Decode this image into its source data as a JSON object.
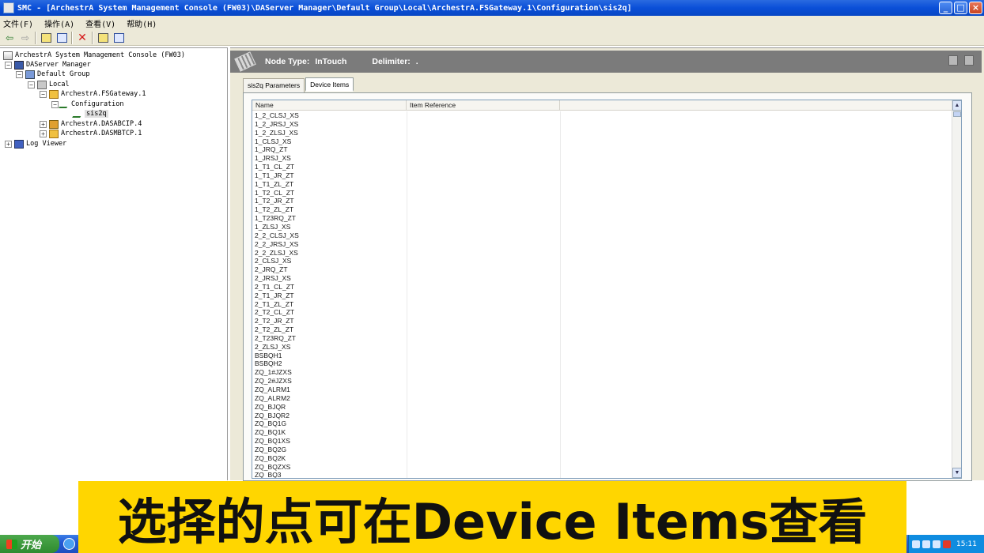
{
  "window": {
    "title": "SMC - [ArchestrA System Management Console (FW03)\\DAServer Manager\\Default Group\\Local\\ArchestrA.FSGateway.1\\Configuration\\sis2q]",
    "buttons": {
      "minimize": "_",
      "maximize": "□",
      "close": "×"
    }
  },
  "menu": [
    "文件(F)",
    "操作(A)",
    "查看(V)",
    "帮助(H)"
  ],
  "toolbar": {
    "back": "⇦",
    "forward": "⇨",
    "delete": "✕"
  },
  "tree": {
    "root": "ArchestrA System Management Console (FW03)",
    "daserver": "DAServer Manager",
    "group": "Default Group",
    "local": "Local",
    "gateway": "ArchestrA.FSGateway.1",
    "configuration": "Configuration",
    "selected": "sis2q",
    "abcip": "ArchestrA.DASABCIP.4",
    "mbtcp": "ArchestrA.DASMBTCP.1",
    "logviewer": "Log Viewer",
    "expand_minus": "−",
    "expand_plus": "+"
  },
  "header": {
    "node_type_label": "Node Type:",
    "node_type_value": "InTouch",
    "delimiter_label": "Delimiter:",
    "delimiter_value": "."
  },
  "tabs": [
    "sis2q Parameters",
    "Device Items"
  ],
  "active_tab": "Device Items",
  "list": {
    "columns": [
      "Name",
      "Item Reference",
      ""
    ],
    "rows": [
      "1_2_CLSJ_XS",
      "1_2_JRSJ_XS",
      "1_2_ZLSJ_XS",
      "1_CLSJ_XS",
      "1_JRQ_ZT",
      "1_JRSJ_XS",
      "1_T1_CL_ZT",
      "1_T1_JR_ZT",
      "1_T1_ZL_ZT",
      "1_T2_CL_ZT",
      "1_T2_JR_ZT",
      "1_T2_ZL_ZT",
      "1_T23RQ_ZT",
      "1_ZLSJ_XS",
      "2_2_CLSJ_XS",
      "2_2_JRSJ_XS",
      "2_2_ZLSJ_XS",
      "2_CLSJ_XS",
      "2_JRQ_ZT",
      "2_JRSJ_XS",
      "2_T1_CL_ZT",
      "2_T1_JR_ZT",
      "2_T1_ZL_ZT",
      "2_T2_CL_ZT",
      "2_T2_JR_ZT",
      "2_T2_ZL_ZT",
      "2_T23RQ_ZT",
      "2_ZLSJ_XS",
      "BSBQH1",
      "BSBQH2",
      "ZQ_1#JZXS",
      "ZQ_2#JZXS",
      "ZQ_ALRM1",
      "ZQ_ALRM2",
      "ZQ_BJQR",
      "ZQ_BJQR2",
      "ZQ_BQ1G",
      "ZQ_BQ1K",
      "ZQ_BQ1XS",
      "ZQ_BQ2G",
      "ZQ_BQ2K",
      "ZQ_BQZXS",
      "ZQ_BQ3"
    ],
    "scroll_up": "▲",
    "scroll_down": "▼"
  },
  "taskbar": {
    "start": "开始",
    "clock": "15:11"
  },
  "subtitle": "选择的点可在Device Items查看"
}
